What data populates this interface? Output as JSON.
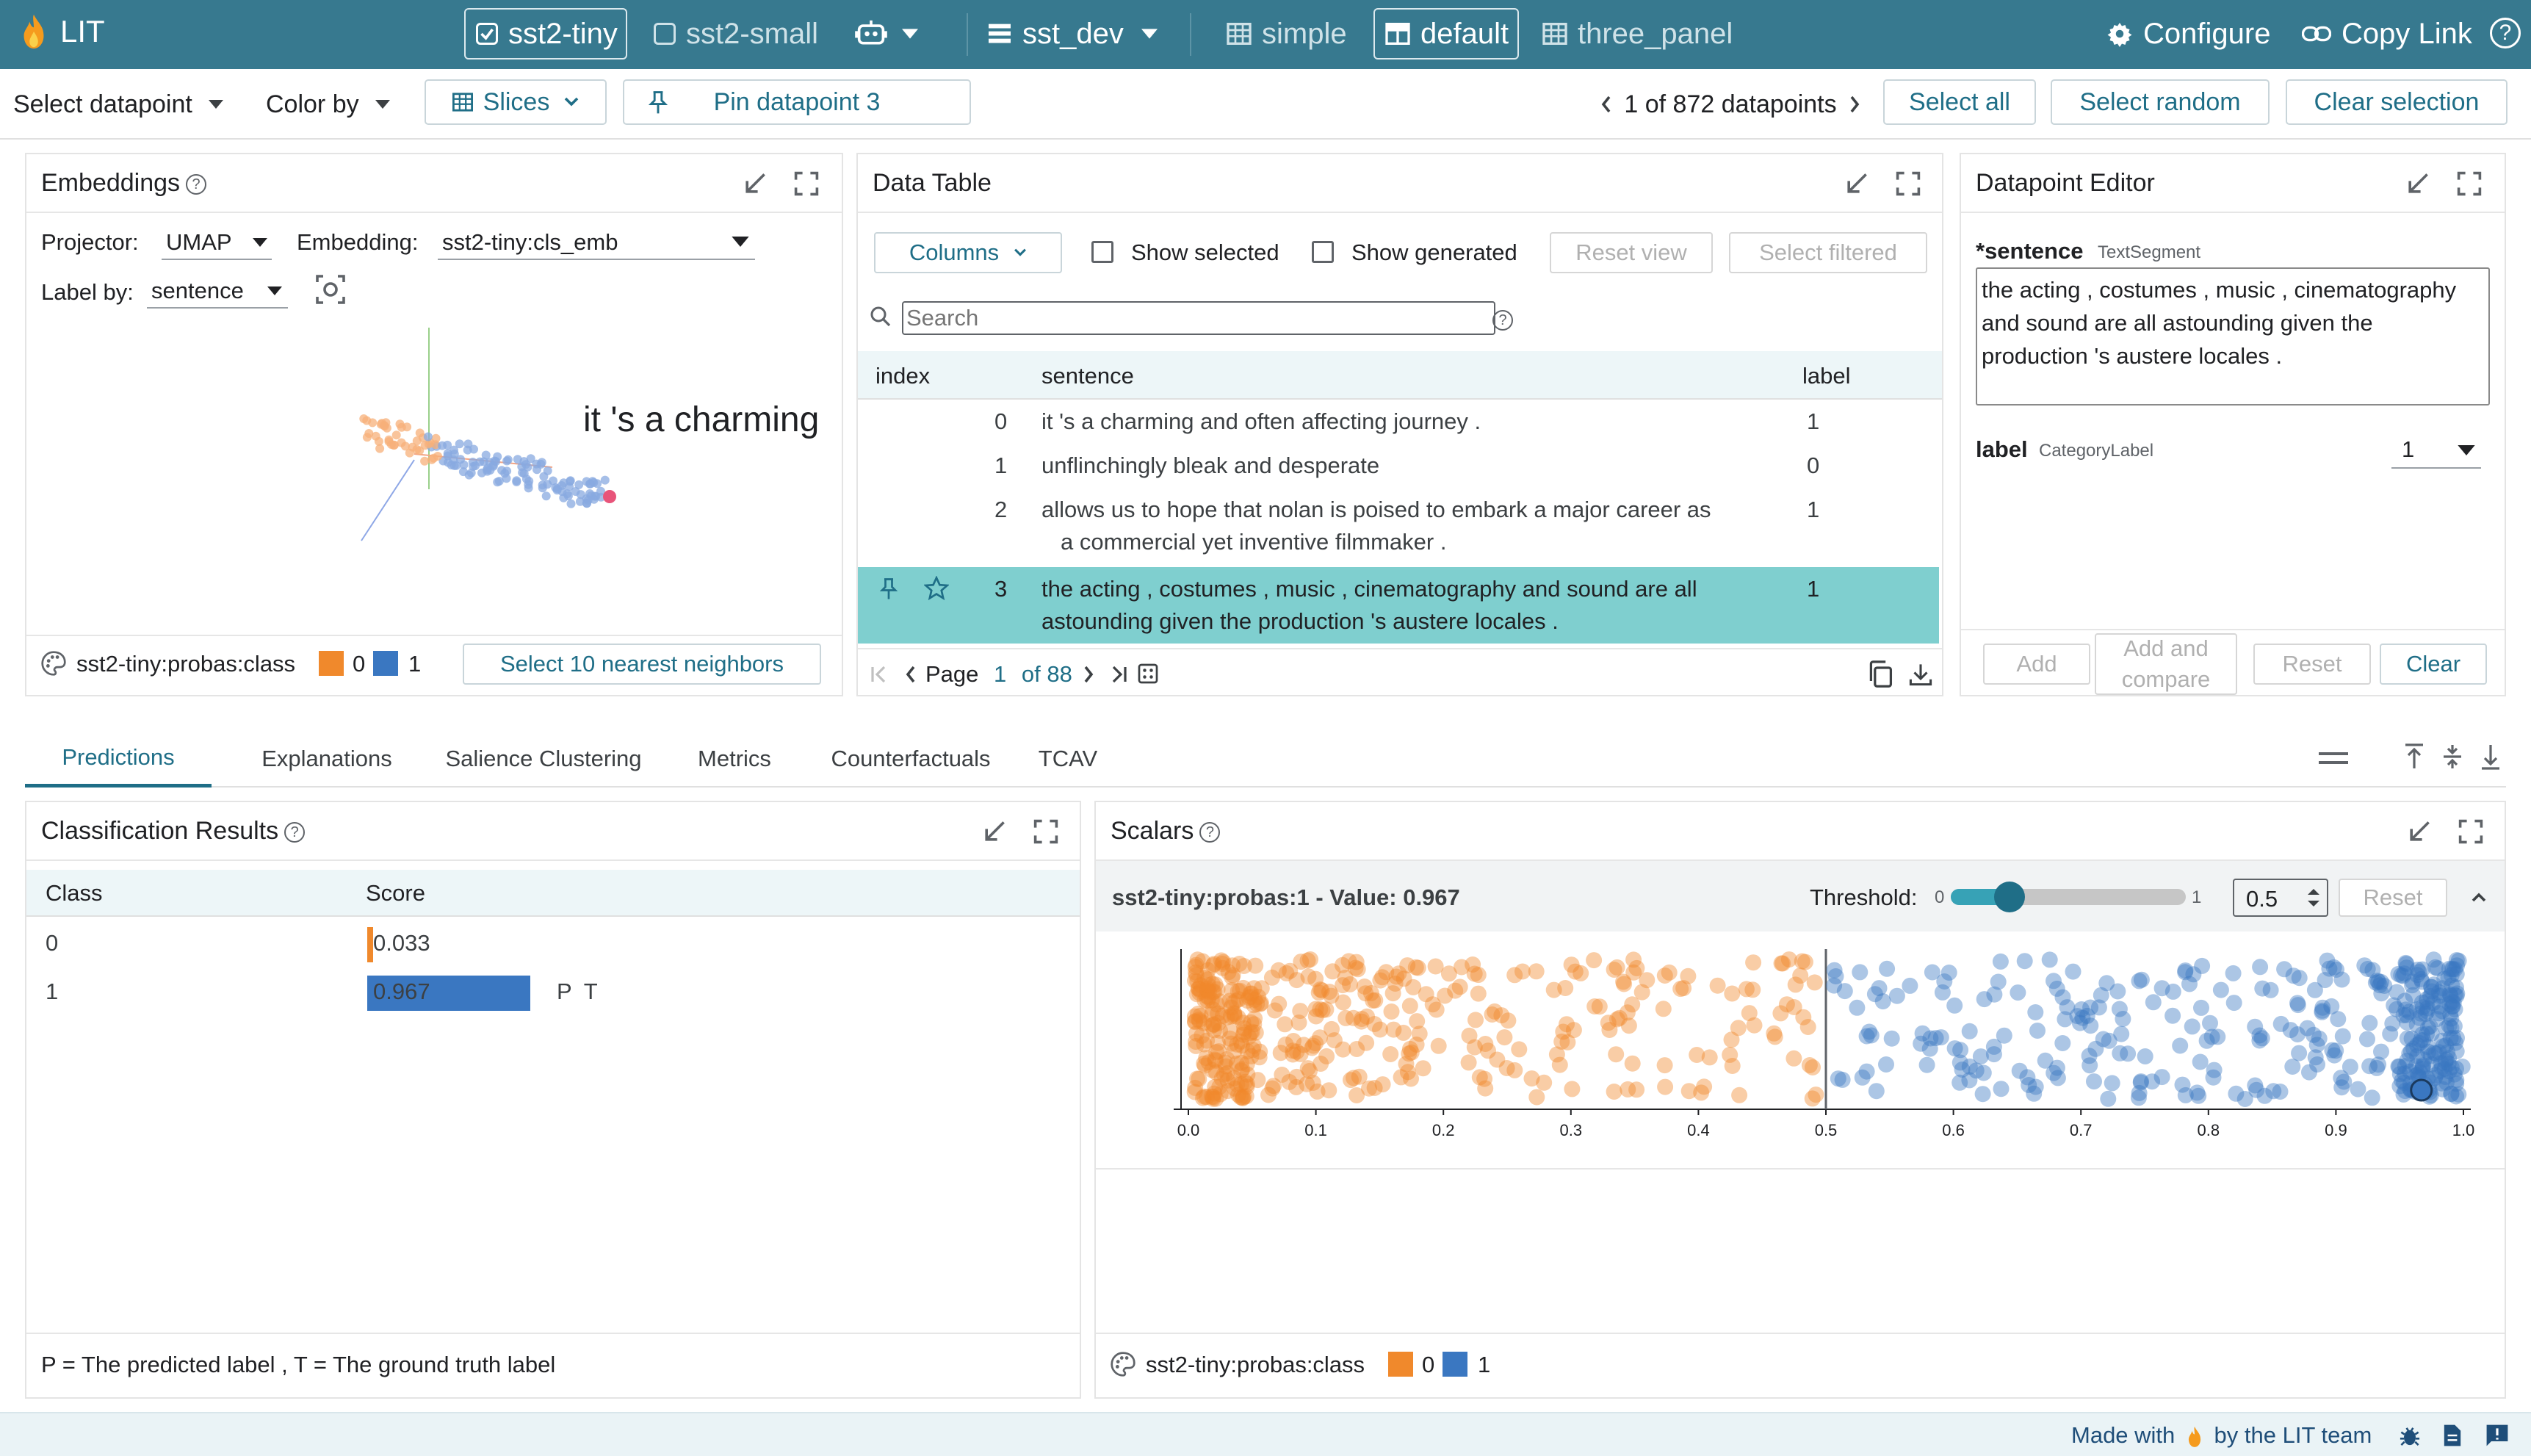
{
  "topbar": {
    "app_name": "LIT",
    "models": [
      {
        "label": "sst2-tiny",
        "selected": true
      },
      {
        "label": "sst2-small",
        "selected": false
      }
    ],
    "dataset": "sst_dev",
    "layouts": [
      {
        "label": "simple",
        "selected": false
      },
      {
        "label": "default",
        "selected": true
      },
      {
        "label": "three_panel",
        "selected": false
      }
    ],
    "configure": "Configure",
    "copy_link": "Copy Link",
    "help": "?"
  },
  "subbar": {
    "select_datapoint": "Select datapoint",
    "color_by": "Color by",
    "slices": "Slices",
    "pin": "Pin datapoint 3",
    "count": "1 of 872 datapoints",
    "select_all": "Select all",
    "select_random": "Select random",
    "clear_selection": "Clear selection"
  },
  "embeddings": {
    "title": "Embeddings",
    "projector_label": "Projector:",
    "projector": "UMAP",
    "embedding_label": "Embedding:",
    "embedding": "sst2-tiny:cls_emb",
    "labelby_label": "Label by:",
    "labelby": "sentence",
    "overlay": "it 's a charming",
    "legend_field": "sst2-tiny:probas:class",
    "legend_0": "0",
    "legend_1": "1",
    "nn_button": "Select 10 nearest neighbors"
  },
  "table": {
    "title": "Data Table",
    "columns_btn": "Columns",
    "show_selected": "Show selected",
    "show_generated": "Show generated",
    "reset_view": "Reset view",
    "select_filtered": "Select filtered",
    "search_placeholder": "Search",
    "headers": {
      "index": "index",
      "sentence": "sentence",
      "label": "label"
    },
    "rows": [
      {
        "index": "0",
        "line1": "it 's a charming and often affecting journey .",
        "line2": "",
        "label": "1"
      },
      {
        "index": "1",
        "line1": "unflinchingly bleak and desperate",
        "line2": "",
        "label": "0"
      },
      {
        "index": "2",
        "line1": "allows us to hope that nolan is poised to embark a major career as",
        "line2": "a commercial yet inventive filmmaker .",
        "label": "1"
      },
      {
        "index": "3",
        "line1": "the acting , costumes , music , cinematography and sound are all",
        "line2": "astounding given the production 's austere locales .",
        "label": "1"
      }
    ],
    "page_label": "Page",
    "page": "1",
    "of_pages": "of 88"
  },
  "editor": {
    "title": "Datapoint Editor",
    "sentence_label": "*sentence",
    "sentence_type": "TextSegment",
    "sentence_value": "the acting , costumes , music , cinematography and sound are all astounding given the production 's austere locales .",
    "label_label": "label",
    "label_type": "CategoryLabel",
    "label_value": "1",
    "add": "Add",
    "add_compare_1": "Add and",
    "add_compare_2": "compare",
    "reset": "Reset",
    "clear": "Clear"
  },
  "tabs": [
    "Predictions",
    "Explanations",
    "Salience Clustering",
    "Metrics",
    "Counterfactuals",
    "TCAV"
  ],
  "classification": {
    "title": "Classification Results",
    "headers": {
      "class": "Class",
      "score": "Score"
    },
    "rows": [
      {
        "class": "0",
        "score": 0.033,
        "score_label": "0.033",
        "tags": ""
      },
      {
        "class": "1",
        "score": 0.967,
        "score_label": "0.967",
        "tags": "P  T"
      }
    ],
    "footer": "P = The predicted label , T = The ground truth label"
  },
  "scalars": {
    "title": "Scalars",
    "header": "sst2-tiny:probas:1 - Value: 0.967",
    "threshold_label": "Threshold:",
    "slider_min": "0",
    "slider_max": "1",
    "threshold": "0.5",
    "threshold_value": 0.5,
    "reset": "Reset",
    "legend_field": "sst2-tiny:probas:class",
    "legend_0": "0",
    "legend_1": "1"
  },
  "chart_data": {
    "type": "scatter",
    "xlim": [
      0,
      1
    ],
    "x_ticks": [
      "0.0",
      "0.1",
      "0.2",
      "0.3",
      "0.4",
      "0.5",
      "0.6",
      "0.7",
      "0.8",
      "0.9",
      "1.0"
    ],
    "threshold_line": 0.5,
    "selected_point": 0.967,
    "series": [
      {
        "name": "0",
        "color": "#f0892c"
      },
      {
        "name": "1",
        "color": "#3a77c1"
      }
    ]
  },
  "footer": {
    "made_with": "Made with",
    "by": "by the LIT team"
  },
  "colors": {
    "accent": "#37798f",
    "orange": "#f0892c",
    "blue": "#3a77c1",
    "selected_row": "#7fcfcf"
  }
}
